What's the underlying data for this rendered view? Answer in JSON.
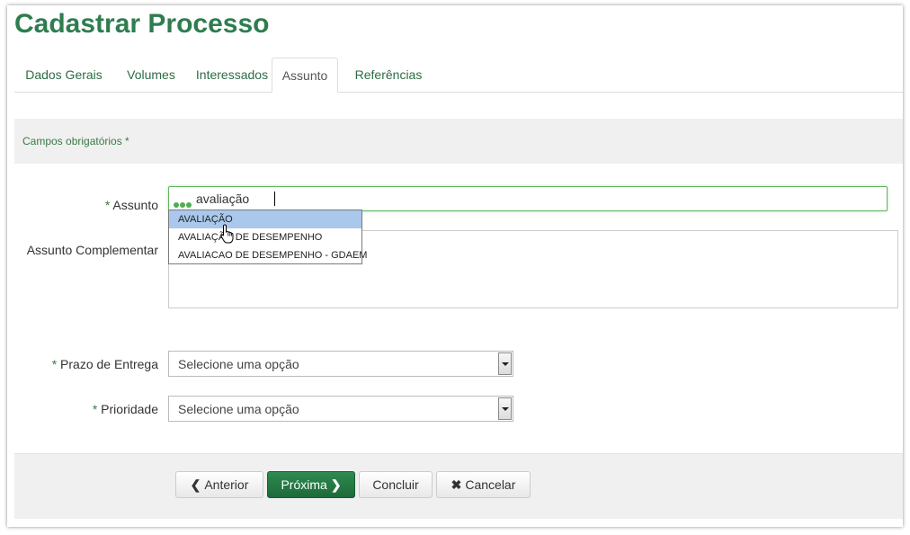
{
  "page": {
    "title": "Cadastrar Processo"
  },
  "tabs": [
    {
      "label": "Dados Gerais"
    },
    {
      "label": "Volumes"
    },
    {
      "label": "Interessados"
    },
    {
      "label": "Assunto",
      "active": true
    },
    {
      "label": "Referências"
    }
  ],
  "form": {
    "required_note": "Campos obrigatórios *",
    "assunto": {
      "required_mark": "*",
      "label": "Assunto",
      "value": "avaliação"
    },
    "suggestions": [
      "AVALIAÇÃO",
      "AVALIAÇÃO DE DESEMPENHO",
      "AVALIACAO DE DESEMPENHO - GDAEM"
    ],
    "assunto_complementar": {
      "label": "Assunto Complementar",
      "value": ""
    },
    "prazo": {
      "required_mark": "*",
      "label": "Prazo de Entrega",
      "selected": "Selecione uma opção"
    },
    "prioridade": {
      "required_mark": "*",
      "label": "Prioridade",
      "selected": "Selecione uma opção"
    }
  },
  "actions": {
    "anterior": "Anterior",
    "proxima": "Próxima",
    "concluir": "Concluir",
    "cancelar": "Cancelar"
  },
  "icons": {
    "loading": "loading-dots-icon",
    "cursor": "hand-pointer-icon",
    "prev": "chevron-left-icon",
    "next": "chevron-right-icon",
    "cancel": "x-icon"
  },
  "colors": {
    "title": "#2e7d4f",
    "primary_button": "#1d6a3a",
    "link": "#2e6b45",
    "highlight": "#a9c8ec"
  }
}
